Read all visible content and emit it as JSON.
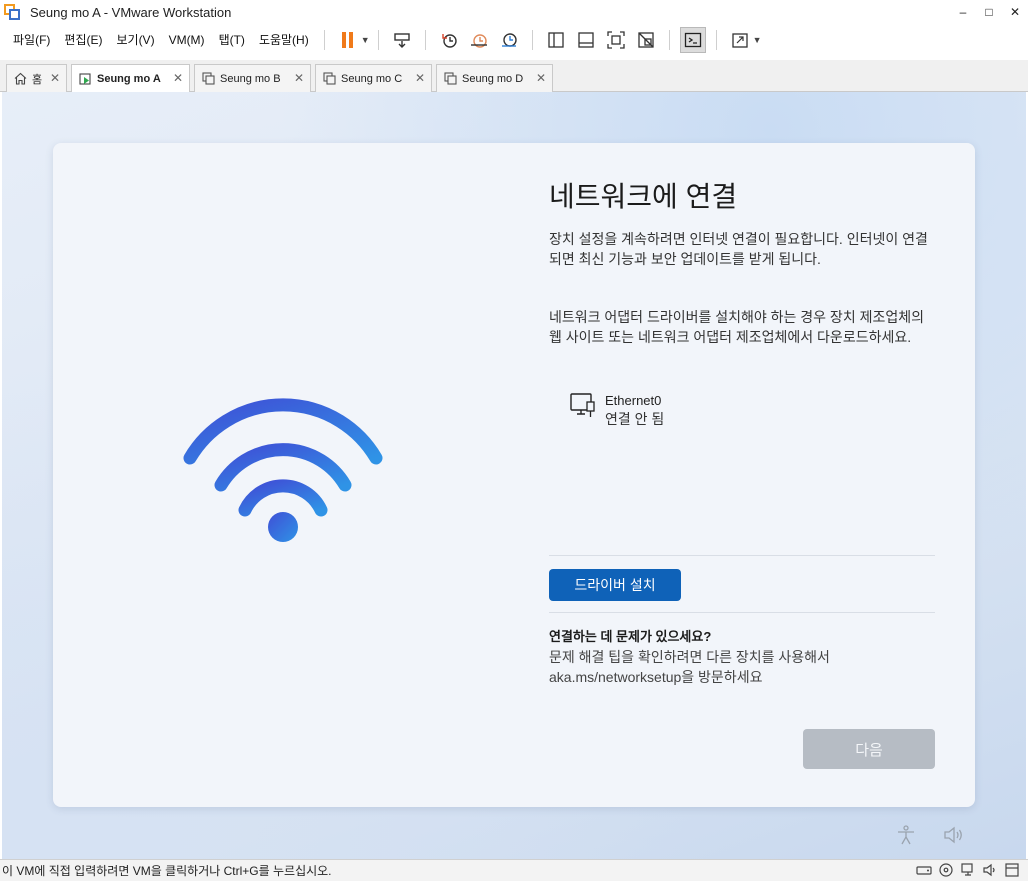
{
  "window": {
    "title": "Seung mo A - VMware Workstation",
    "minimize": "–",
    "maximize": "□",
    "close": "✕"
  },
  "menu": [
    "파일(F)",
    "편집(E)",
    "보기(V)",
    "VM(M)",
    "탭(T)",
    "도움말(H)"
  ],
  "tabs": [
    {
      "label": "홈",
      "icon": "home-icon"
    },
    {
      "label": "Seung mo A",
      "icon": "vm-running-icon",
      "active": true
    },
    {
      "label": "Seung mo B",
      "icon": "vm-icon"
    },
    {
      "label": "Seung mo C",
      "icon": "vm-icon"
    },
    {
      "label": "Seung mo D",
      "icon": "vm-icon"
    }
  ],
  "oobe": {
    "title": "네트워크에 연결",
    "desc1": "장치 설정을 계속하려면 인터넷 연결이 필요합니다. 인터넷이 연결되면 최신 기능과 보안 업데이트를 받게 됩니다.",
    "desc2": "네트워크 어댑터 드라이버를 설치해야 하는 경우 장치 제조업체의 웹 사이트 또는 네트워크 어댑터 제조업체에서 다운로드하세요.",
    "network": {
      "name": "Ethernet0",
      "status": "연결 안 됨"
    },
    "driver_button": "드라이버 설치",
    "help_title": "연결하는 데 문제가 있으세요?",
    "help_text1": "문제 해결 팁을 확인하려면 다른 장치를 사용해서",
    "help_text2": "aka.ms/networksetup을 방문하세요",
    "next_button": "다음"
  },
  "status": {
    "text": "이 VM에 직접 입력하려면 VM을 클릭하거나 Ctrl+G를 누르십시오."
  },
  "colors": {
    "accent": "#0f62b8",
    "wifi_start": "#3f4fd6",
    "wifi_end": "#2f93e6",
    "disabled_button": "#b6bcc4",
    "pause": "#f07a1a"
  }
}
